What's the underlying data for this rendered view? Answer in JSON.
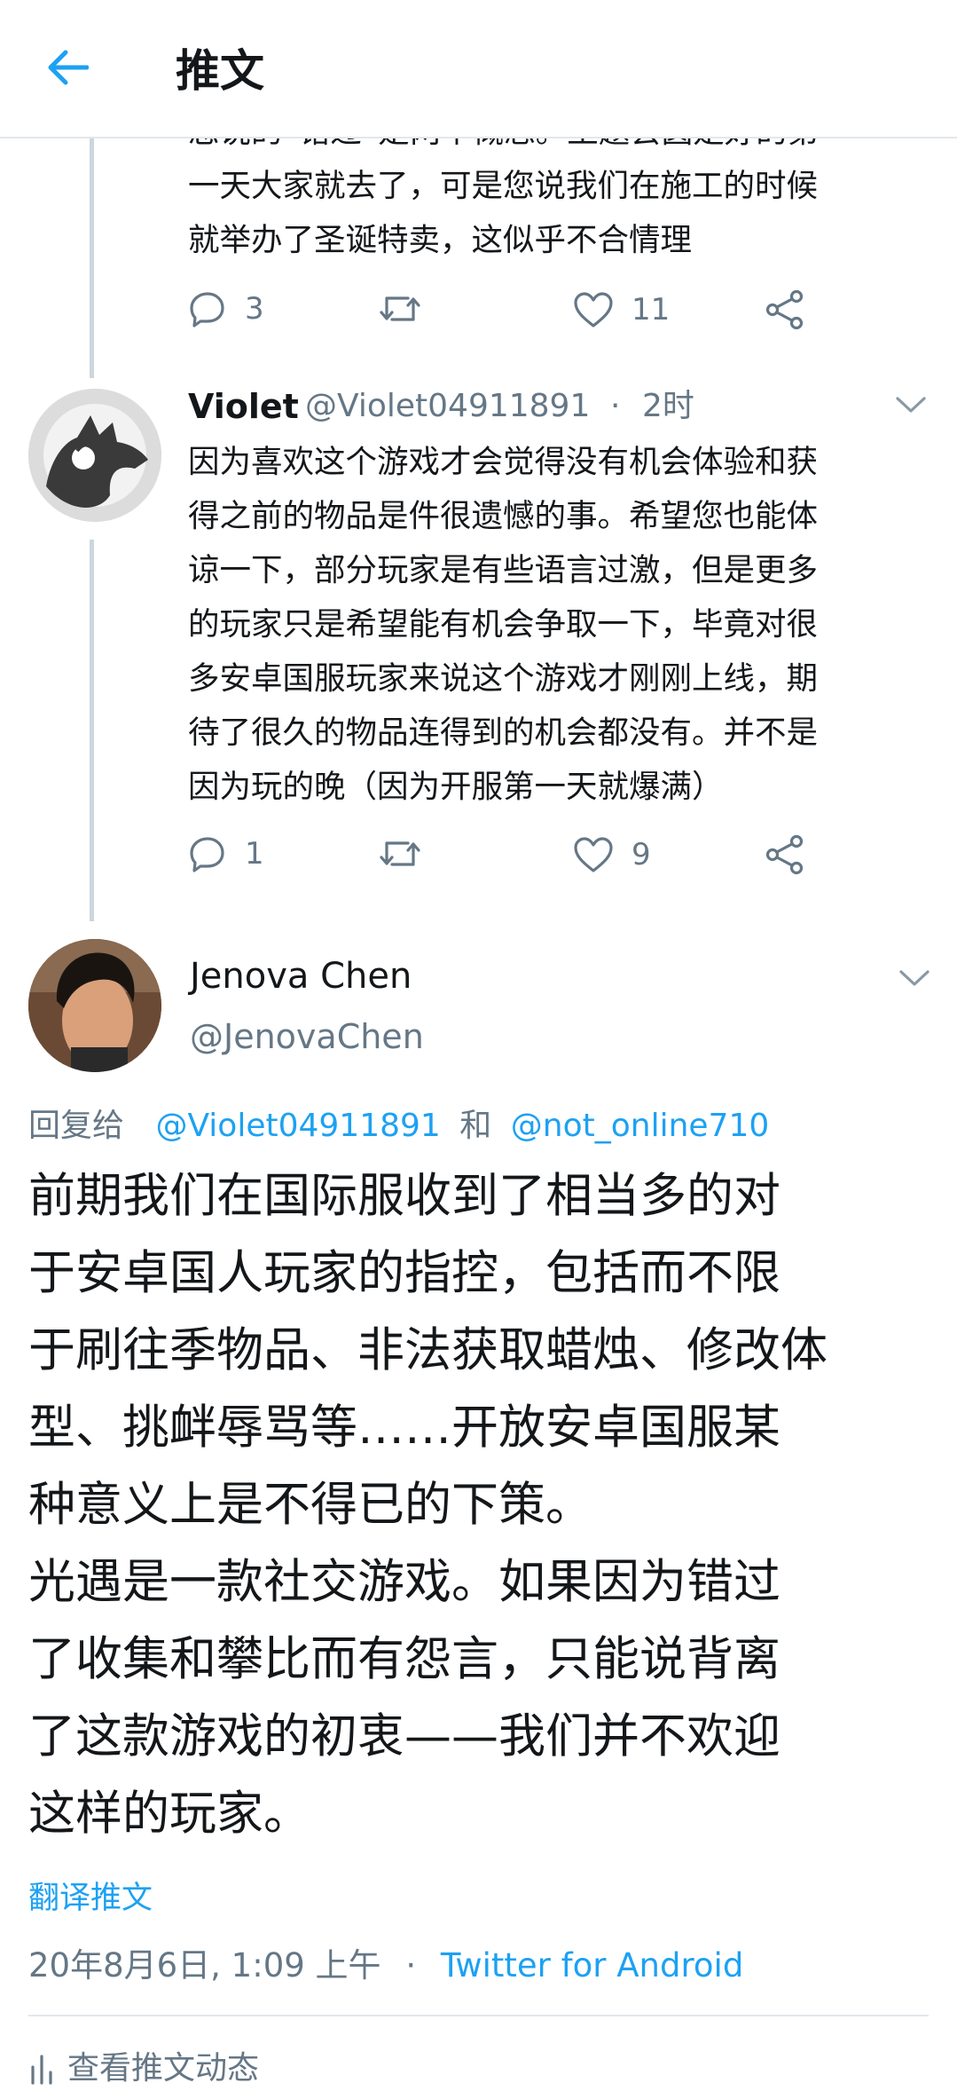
{
  "header": {
    "title": "推文"
  },
  "prev_tweet": {
    "lines": [
      "您说的“错过”是两个概念。土题会圆是好的第",
      "一天大家就去了，可是您说我们在施工的时候",
      "就举办了圣诞特卖，这似乎不合情理"
    ],
    "replies": "3",
    "likes": "11"
  },
  "violet_tweet": {
    "name": "Violet",
    "handle": "@Violet04911891",
    "separator": "·",
    "time": "2时",
    "lines": [
      "因为喜欢这个游戏才会觉得没有机会体验和获",
      "得之前的物品是件很遗憾的事。希望您也能体",
      "谅一下，部分玩家是有些语言过激，但是更多",
      "的玩家只是希望能有机会争取一下，毕竟对很",
      "多安卓国服玩家来说这个游戏才刚刚上线，期",
      "待了很久的物品连得到的机会都没有。并不是",
      "因为玩的晚（因为开服第一天就爆满）"
    ],
    "replies": "1",
    "likes": "9"
  },
  "main_tweet": {
    "name": "Jenova Chen",
    "handle": "@JenovaChen",
    "reply_to_label": "回复给",
    "reply_to_user1": "@Violet04911891",
    "reply_to_and": "和",
    "reply_to_user2": "@not_online710",
    "lines": [
      "前期我们在国际服收到了相当多的对",
      "于安卓国人玩家的指控，包括而不限",
      "于刷往季物品、非法获取蜡烛、修改体",
      "型、挑衅辱骂等……开放安卓国服某",
      "种意义上是不得已的下策。",
      "光遇是一款社交游戏。如果因为错过",
      "了收集和攀比而有怨言，只能说背离",
      "了这款游戏的初衷——我们并不欢迎",
      "这样的玩家。"
    ],
    "translate": "翻译推文",
    "timestamp": "20年8月6日, 1:09 上午",
    "dot": "·",
    "source": "Twitter for Android",
    "activity": "查看推文动态"
  },
  "colors": {
    "accent": "#1da1f2",
    "secondary_text": "#657786",
    "primary_text": "#14171a",
    "thread_line": "#ccd6dd"
  }
}
